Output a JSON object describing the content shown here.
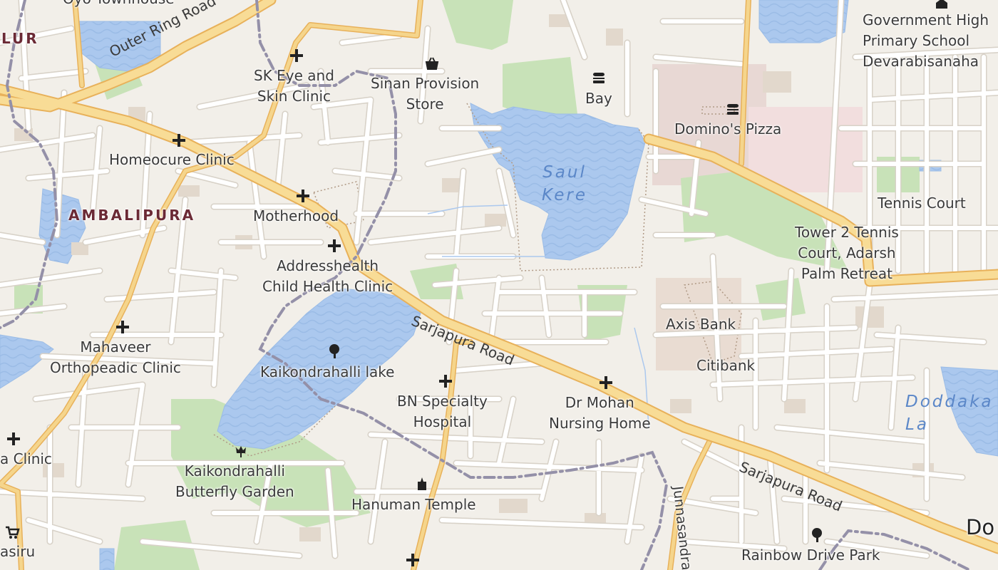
{
  "colors": {
    "background": "#f2efe9",
    "water": "#abc8ee",
    "park": "#c8e2b8",
    "primary_road": "#f5d58c",
    "primary_road_casing": "#e8b15a",
    "minor_road": "#ffffff",
    "minor_road_casing": "#d8d2c8",
    "boundary": "#9490a8",
    "building": "#e2d8cc",
    "place_label": "#6b2a35",
    "water_label": "#5b87c8"
  },
  "places": [
    {
      "name": "AMBALIPURA"
    },
    {
      "name": "LUR"
    }
  ],
  "water_bodies": [
    {
      "name": "Saul\nKere"
    },
    {
      "name": "Doddaka\nLa"
    }
  ],
  "roads": [
    {
      "name": "Outer Ring Road"
    },
    {
      "name": "Sarjapura Road"
    },
    {
      "name": "Sarjapura Road"
    },
    {
      "name": "Junnasandra"
    }
  ],
  "pois": [
    {
      "name": "Oyo Townhouse",
      "icon": "hotel-icon"
    },
    {
      "name": "SK Eye and\nSkin Clinic",
      "icon": "clinic-cross-icon"
    },
    {
      "name": "Sinan Provision\nStore",
      "icon": "shopping-basket-icon"
    },
    {
      "name": "Bay",
      "icon": "fast-food-icon"
    },
    {
      "name": "Domino's Pizza",
      "icon": "fast-food-icon"
    },
    {
      "name": "Government High\nPrimary School\nDevarabisanaha",
      "icon": "school-icon"
    },
    {
      "name": "Homeocure Clinic",
      "icon": "clinic-cross-icon"
    },
    {
      "name": "Motherhood",
      "icon": "clinic-cross-icon"
    },
    {
      "name": "Addresshealth\nChild Health Clinic",
      "icon": "clinic-cross-icon"
    },
    {
      "name": "Tennis Court",
      "icon": ""
    },
    {
      "name": "Tower 2 Tennis\nCourt, Adarsh\nPalm Retreat",
      "icon": ""
    },
    {
      "name": "Axis Bank",
      "icon": ""
    },
    {
      "name": "Citibank",
      "icon": ""
    },
    {
      "name": "Mahaveer\nOrthopeadic Clinic",
      "icon": "clinic-cross-icon"
    },
    {
      "name": "Kaikondrahalli lake",
      "icon": "tree-icon"
    },
    {
      "name": "BN Specialty\nHospital",
      "icon": "clinic-cross-icon"
    },
    {
      "name": "Dr Mohan\nNursing Home",
      "icon": "clinic-cross-icon"
    },
    {
      "name": "a Clinic",
      "icon": "clinic-cross-icon"
    },
    {
      "name": "Kaikondrahalli\nButterfly Garden",
      "icon": "garden-flower-icon"
    },
    {
      "name": "Hanuman Temple",
      "icon": "temple-icon"
    },
    {
      "name": "asiru",
      "icon": "shopping-cart-icon"
    },
    {
      "name": "Rainbow Drive Park",
      "icon": "tree-icon"
    },
    {
      "name": "Do",
      "icon": ""
    }
  ]
}
